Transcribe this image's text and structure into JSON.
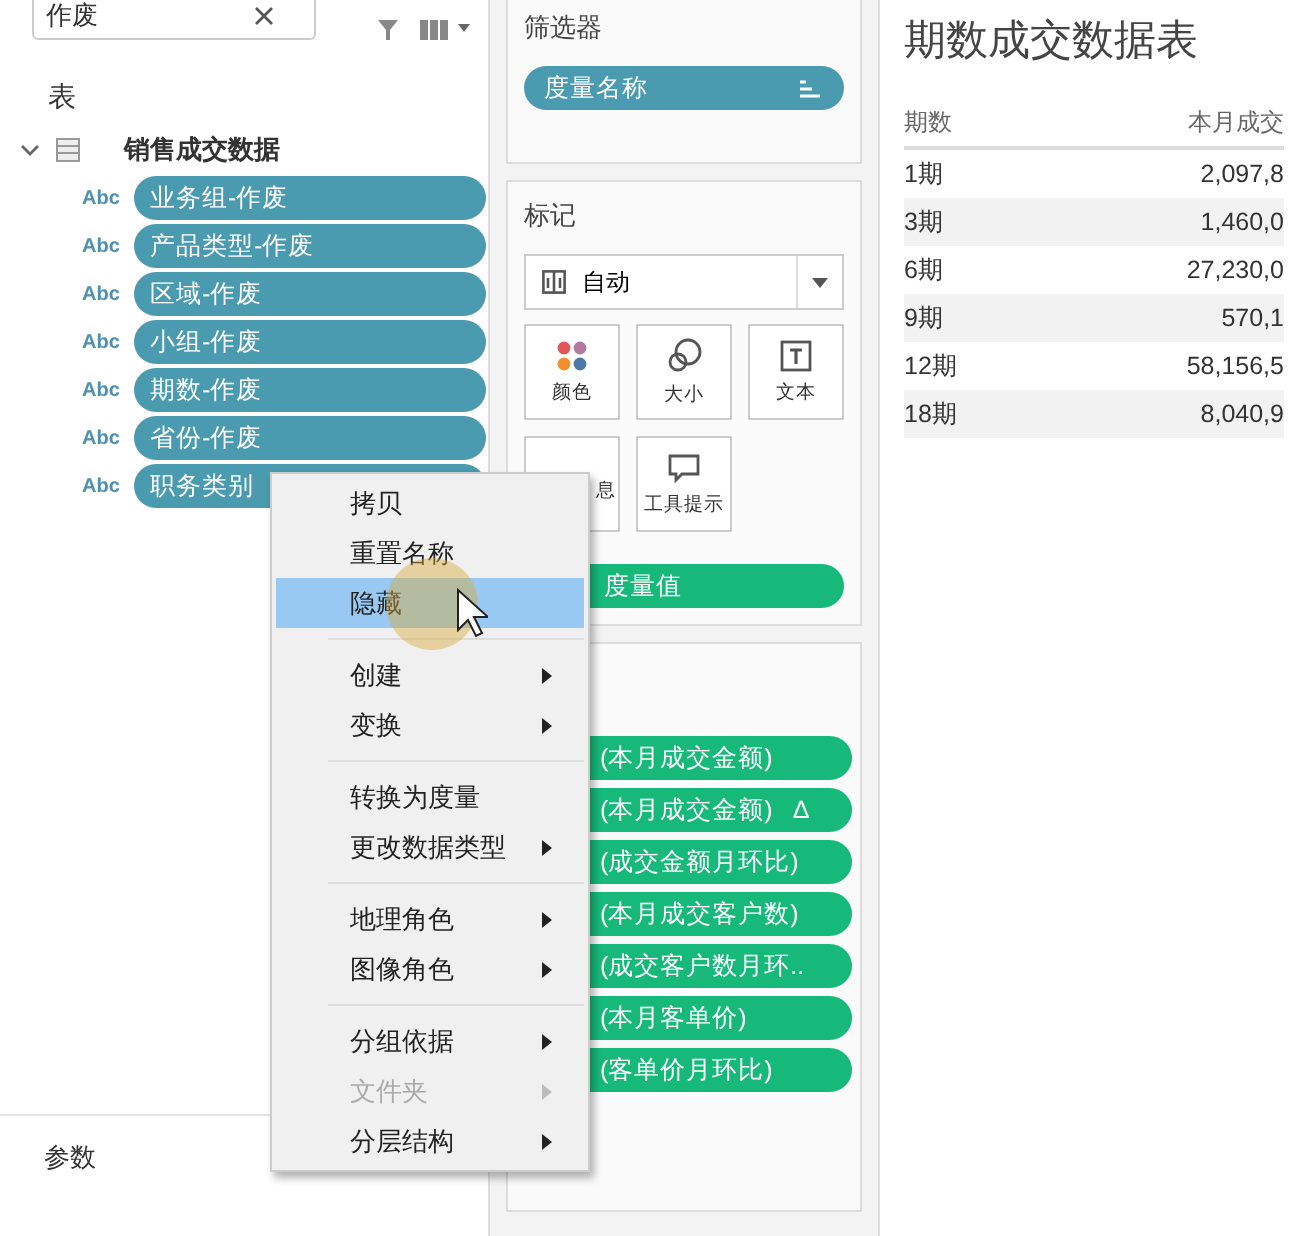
{
  "data_pane": {
    "search": {
      "value": "作废"
    },
    "section_title": "表",
    "table": {
      "name": "销售成交数据",
      "expanded": true
    },
    "fields": [
      {
        "type_label": "Abc",
        "name": "业务组-作废",
        "selected": true
      },
      {
        "type_label": "Abc",
        "name": "产品类型-作废",
        "selected": true
      },
      {
        "type_label": "Abc",
        "name": "区域-作废",
        "selected": true
      },
      {
        "type_label": "Abc",
        "name": "小组-作废",
        "selected": true
      },
      {
        "type_label": "Abc",
        "name": "期数-作废",
        "selected": true
      },
      {
        "type_label": "Abc",
        "name": "省份-作废",
        "selected": true
      },
      {
        "type_label": "Abc",
        "name": "职务类别",
        "selected": true
      }
    ],
    "parameters_title": "参数"
  },
  "filters_card": {
    "title": "筛选器",
    "pills": [
      {
        "label": "度量名称"
      }
    ]
  },
  "marks_card": {
    "title": "标记",
    "mark_type": "自动",
    "buttons": [
      {
        "kind": "color",
        "label": "颜色"
      },
      {
        "kind": "size",
        "label": "大小"
      },
      {
        "kind": "text",
        "label": "文本"
      },
      {
        "kind": "detail",
        "label": "息"
      },
      {
        "kind": "tooltip",
        "label": "工具提示"
      }
    ],
    "pills": [
      {
        "label": "度量值"
      }
    ]
  },
  "measure_values_card": {
    "pills": [
      {
        "label": "(本月成交金额)"
      },
      {
        "label": "(本月成交金额)",
        "badge": "Δ"
      },
      {
        "label": "(成交金额月环比)"
      },
      {
        "label": "(本月成交客户数)"
      },
      {
        "label": "(成交客户数月环.."
      },
      {
        "label": "(本月客单价)"
      },
      {
        "label": "(客单价月环比)"
      }
    ]
  },
  "sheet": {
    "title": "期数成交数据表",
    "columns": [
      "期数",
      "本月成交"
    ],
    "rows": [
      {
        "cells": [
          "1期",
          "2,097,8"
        ]
      },
      {
        "cells": [
          "3期",
          "1,460,0"
        ]
      },
      {
        "cells": [
          "6期",
          "27,230,0"
        ]
      },
      {
        "cells": [
          "9期",
          "570,1"
        ]
      },
      {
        "cells": [
          "12期",
          "58,156,5"
        ]
      },
      {
        "cells": [
          "18期",
          "8,040,9"
        ]
      }
    ]
  },
  "context_menu": {
    "items": [
      {
        "kind": "item",
        "label": "拷贝",
        "selected": false,
        "disabled": false,
        "submenu": false
      },
      {
        "kind": "item",
        "label": "重置名称",
        "selected": false,
        "disabled": false,
        "submenu": false
      },
      {
        "kind": "item",
        "label": "隐藏",
        "selected": true,
        "disabled": false,
        "submenu": false
      },
      {
        "kind": "separator"
      },
      {
        "kind": "item",
        "label": "创建",
        "selected": false,
        "disabled": false,
        "submenu": true
      },
      {
        "kind": "item",
        "label": "变换",
        "selected": false,
        "disabled": false,
        "submenu": true
      },
      {
        "kind": "separator"
      },
      {
        "kind": "item",
        "label": "转换为度量",
        "selected": false,
        "disabled": false,
        "submenu": false
      },
      {
        "kind": "item",
        "label": "更改数据类型",
        "selected": false,
        "disabled": false,
        "submenu": true
      },
      {
        "kind": "separator"
      },
      {
        "kind": "item",
        "label": "地理角色",
        "selected": false,
        "disabled": false,
        "submenu": true
      },
      {
        "kind": "item",
        "label": "图像角色",
        "selected": false,
        "disabled": false,
        "submenu": true
      },
      {
        "kind": "separator"
      },
      {
        "kind": "item",
        "label": "分组依据",
        "selected": false,
        "disabled": false,
        "submenu": true
      },
      {
        "kind": "item",
        "label": "文件夹",
        "selected": false,
        "disabled": true,
        "submenu": true
      },
      {
        "kind": "item",
        "label": "分层结构",
        "selected": false,
        "disabled": false,
        "submenu": true
      }
    ]
  }
}
